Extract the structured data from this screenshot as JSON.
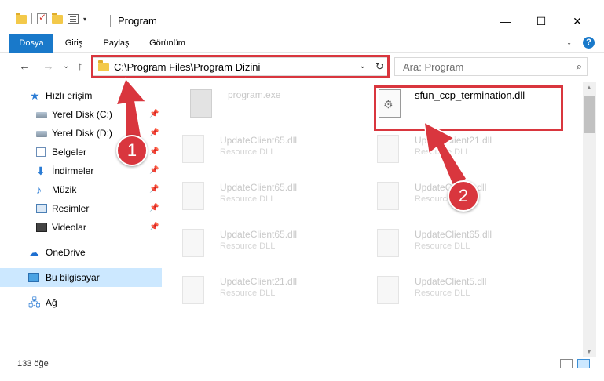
{
  "window": {
    "title": "Program",
    "controls": {
      "minimize": "—",
      "maximize": "☐",
      "close": "✕"
    }
  },
  "ribbon": {
    "tabs": [
      "Dosya",
      "Giriş",
      "Paylaş",
      "Görünüm"
    ]
  },
  "nav": {
    "address": "C:\\Program Files\\Program Dizini",
    "search_placeholder": "Ara: Program"
  },
  "sidebar": {
    "items": [
      {
        "label": "Hızlı erişim",
        "icon": "star-icon"
      },
      {
        "label": "Yerel Disk (C:)",
        "icon": "drive-icon",
        "pinned": true
      },
      {
        "label": "Yerel Disk (D:)",
        "icon": "drive-icon",
        "pinned": true
      },
      {
        "label": "Belgeler",
        "icon": "documents-icon",
        "pinned": true
      },
      {
        "label": "İndirmeler",
        "icon": "download-icon",
        "pinned": true
      },
      {
        "label": "Müzik",
        "icon": "music-icon",
        "pinned": true
      },
      {
        "label": "Resimler",
        "icon": "pictures-icon",
        "pinned": true
      },
      {
        "label": "Videolar",
        "icon": "videos-icon",
        "pinned": true
      },
      {
        "label": "OneDrive",
        "icon": "cloud-icon"
      },
      {
        "label": "Bu bilgisayar",
        "icon": "computer-icon",
        "selected": true
      },
      {
        "label": "Ağ",
        "icon": "network-icon"
      }
    ]
  },
  "files": [
    {
      "name": "program.exe",
      "type": ""
    },
    {
      "name": "sfun_ccp_termination.dll",
      "type": "",
      "highlighted": true
    },
    {
      "name": "UpdateClient65.dll",
      "type": "Resource DLL"
    },
    {
      "name": "UpdateClient21.dll",
      "type": "Resource DLL"
    },
    {
      "name": "UpdateClient65.dll",
      "type": "Resource DLL"
    },
    {
      "name": "UpdateClient9.dll",
      "type": "Resource DLL"
    },
    {
      "name": "UpdateClient65.dll",
      "type": "Resource DLL"
    },
    {
      "name": "UpdateClient65.dll",
      "type": "Resource DLL"
    },
    {
      "name": "UpdateClient21.dll",
      "type": "Resource DLL"
    },
    {
      "name": "UpdateClient5.dll",
      "type": "Resource DLL"
    }
  ],
  "status": {
    "item_count": "133 öğe"
  },
  "annotations": {
    "step1": "1",
    "step2": "2",
    "color": "#d9363e"
  }
}
